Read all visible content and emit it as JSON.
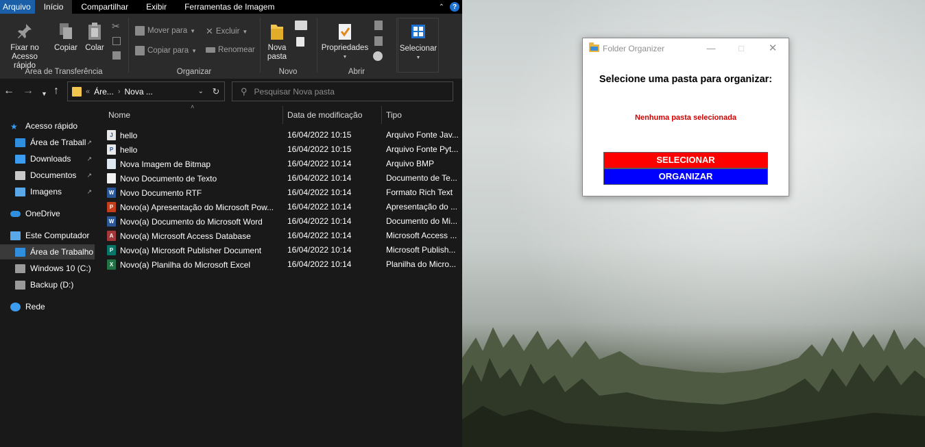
{
  "explorer": {
    "tabs": [
      "Arquivo",
      "Início",
      "Compartilhar",
      "Exibir",
      "Ferramentas de Imagem"
    ],
    "help_icon": "?",
    "ribbon": {
      "clipboard": {
        "pin_label_1": "Fixar no",
        "pin_label_2": "Acesso rápido",
        "copy": "Copiar",
        "paste": "Colar",
        "group": "Área de Transferência"
      },
      "organize": {
        "move_to": "Mover para",
        "copy_to": "Copiar para",
        "delete": "Excluir",
        "rename": "Renomear",
        "group": "Organizar"
      },
      "new": {
        "new_folder_1": "Nova",
        "new_folder_2": "pasta",
        "group": "Novo"
      },
      "open": {
        "properties": "Propriedades",
        "group": "Abrir"
      },
      "select": {
        "select": "Selecionar"
      }
    },
    "address": {
      "crumb_1": "Áre...",
      "crumb_2": "Nova ...",
      "separator": "«",
      "arrow": "›"
    },
    "search": {
      "placeholder": "Pesquisar Nova pasta"
    },
    "nav": [
      {
        "label": "Acesso rápido",
        "icon": "star-icon"
      },
      {
        "label": "Área de Traball",
        "icon": "desktop-icon",
        "pinned": true
      },
      {
        "label": "Downloads",
        "icon": "download-icon",
        "pinned": true
      },
      {
        "label": "Documentos",
        "icon": "documents-icon",
        "pinned": true
      },
      {
        "label": "Imagens",
        "icon": "pictures-icon",
        "pinned": true
      },
      {
        "label": "OneDrive",
        "icon": "cloud-icon"
      },
      {
        "label": "Este Computador",
        "icon": "computer-icon"
      },
      {
        "label": "Área de Trabalho",
        "icon": "desktop-icon",
        "selected": true
      },
      {
        "label": "Windows 10 (C:)",
        "icon": "drive-icon"
      },
      {
        "label": "Backup (D:)",
        "icon": "drive-icon"
      },
      {
        "label": "Rede",
        "icon": "network-icon"
      }
    ],
    "columns": {
      "name": "Nome",
      "date": "Data de modificação",
      "type": "Tipo"
    },
    "files": [
      {
        "name": "hello",
        "date": "16/04/2022 10:15",
        "type": "Arquivo Fonte Jav...",
        "icon": "java-file-icon",
        "color": "#e8e8e8"
      },
      {
        "name": "hello",
        "date": "16/04/2022 10:15",
        "type": "Arquivo Fonte Pyt...",
        "icon": "python-file-icon",
        "color": "#e8e8e8"
      },
      {
        "name": "Nova Imagem de Bitmap",
        "date": "16/04/2022 10:14",
        "type": "Arquivo BMP",
        "icon": "bitmap-file-icon",
        "color": "#dfe8f0"
      },
      {
        "name": "Novo Documento de Texto",
        "date": "16/04/2022 10:14",
        "type": "Documento de Te...",
        "icon": "text-file-icon",
        "color": "#f2f2f2"
      },
      {
        "name": "Novo Documento RTF",
        "date": "16/04/2022 10:14",
        "type": "Formato Rich Text",
        "icon": "word-file-icon",
        "color": "#2b5797"
      },
      {
        "name": "Novo(a) Apresentação do Microsoft Pow...",
        "date": "16/04/2022 10:14",
        "type": "Apresentação do ...",
        "icon": "powerpoint-file-icon",
        "color": "#c43e1c"
      },
      {
        "name": "Novo(a) Documento do Microsoft Word",
        "date": "16/04/2022 10:14",
        "type": "Documento do Mi...",
        "icon": "word-file-icon",
        "color": "#2b5797"
      },
      {
        "name": "Novo(a) Microsoft Access Database",
        "date": "16/04/2022 10:14",
        "type": "Microsoft Access ...",
        "icon": "access-file-icon",
        "color": "#a4373a"
      },
      {
        "name": "Novo(a) Microsoft Publisher Document",
        "date": "16/04/2022 10:14",
        "type": "Microsoft Publish...",
        "icon": "publisher-file-icon",
        "color": "#077568"
      },
      {
        "name": "Novo(a) Planilha do Microsoft Excel",
        "date": "16/04/2022 10:14",
        "type": "Planilha do Micro...",
        "icon": "excel-file-icon",
        "color": "#217346"
      }
    ]
  },
  "dialog": {
    "title": "Folder Organizer",
    "heading": "Selecione uma pasta para organizar:",
    "status": "Nenhuma pasta selecionada",
    "select_button": "SELECIONAR",
    "organize_button": "ORGANIZAR",
    "colors": {
      "select": "#ff0000",
      "organize": "#0000ff",
      "status": "#d20000"
    }
  }
}
